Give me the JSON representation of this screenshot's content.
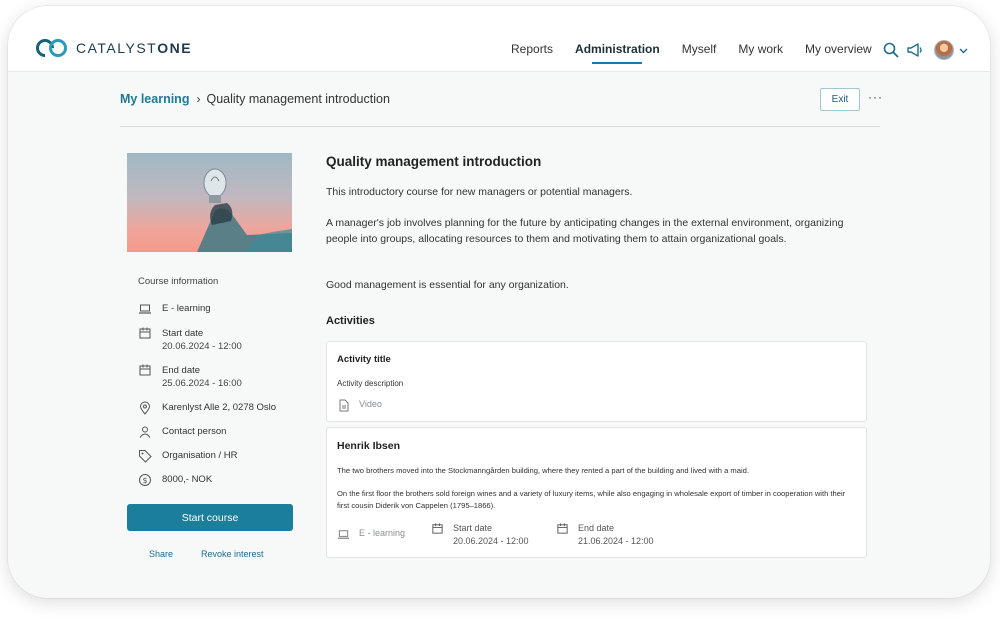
{
  "app": {
    "logo_text_light": "CATALYST",
    "logo_text_bold": "ONE"
  },
  "nav": {
    "items": [
      {
        "label": "Reports",
        "active": false
      },
      {
        "label": "Administration",
        "active": true
      },
      {
        "label": "Myself",
        "active": false
      },
      {
        "label": "My work",
        "active": false
      },
      {
        "label": "My overview",
        "active": false
      }
    ],
    "icons": [
      "search-icon",
      "megaphone-icon",
      "avatar",
      "chevron-down-icon"
    ]
  },
  "breadcrumb": {
    "root": "My learning",
    "separator": "›",
    "current": "Quality management introduction"
  },
  "actions": {
    "exit_label": "Exit",
    "more_label": "···"
  },
  "course_info": {
    "title": "Course information",
    "type": "E - learning",
    "start_label": "Start date",
    "start_value": "20.06.2024 - 12:00",
    "end_label": "End date",
    "end_value": "25.06.2024 - 16:00",
    "location": "Karenlyst Alle 2, 0278 Oslo",
    "contact": "Contact person",
    "organisation": "Organisation / HR",
    "price": "8000,- NOK",
    "start_button": "Start course",
    "share_link": "Share",
    "revoke_link": "Revoke interest"
  },
  "course": {
    "title": "Quality management introduction",
    "intro": "This introductory course for new managers or potential managers.",
    "description": "A  manager's job involves planning for the future by anticipating changes  in the external environment, organizing people into groups, allocating  resources to them and motivating them to attain organizational goals.",
    "closing": "Good management is essential for any organization."
  },
  "activities": {
    "heading": "Activities",
    "items": [
      {
        "title": "Activity title",
        "description": "Activity description",
        "type": "Video"
      },
      {
        "title": "Henrik Ibsen",
        "text1": "The two brothers moved into the Stockmanngården building, where they  rented a part of the building and lived with a maid.",
        "text2": "On the first floor  the brothers sold foreign wines and a variety of luxury items, while  also engaging in wholesale export of timber in cooperation with their  first cousin Diderik von Cappelen (1795–1866).",
        "type": "E - learning",
        "start_label": "Start date",
        "start_value": "20.06.2024 - 12:00",
        "end_label": "End date",
        "end_value": "21.06.2024 - 12:00"
      }
    ]
  },
  "colors": {
    "accent": "#1b7f9c",
    "brand_dark": "#17607a",
    "link": "#1d7a98"
  }
}
